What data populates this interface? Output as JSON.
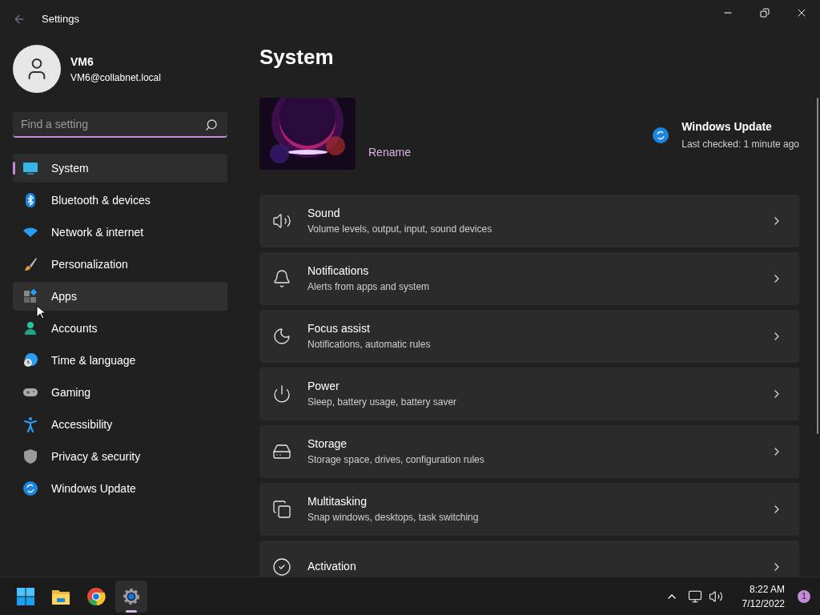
{
  "window": {
    "title": "Settings"
  },
  "user": {
    "name": "VM6",
    "email": "VM6@collabnet.local"
  },
  "search": {
    "placeholder": "Find a setting"
  },
  "sidebar": {
    "items": [
      {
        "label": "System",
        "selected": true,
        "hovered": false
      },
      {
        "label": "Bluetooth & devices",
        "selected": false,
        "hovered": false
      },
      {
        "label": "Network & internet",
        "selected": false,
        "hovered": false
      },
      {
        "label": "Personalization",
        "selected": false,
        "hovered": false
      },
      {
        "label": "Apps",
        "selected": false,
        "hovered": true
      },
      {
        "label": "Accounts",
        "selected": false,
        "hovered": false
      },
      {
        "label": "Time & language",
        "selected": false,
        "hovered": false
      },
      {
        "label": "Gaming",
        "selected": false,
        "hovered": false
      },
      {
        "label": "Accessibility",
        "selected": false,
        "hovered": false
      },
      {
        "label": "Privacy & security",
        "selected": false,
        "hovered": false
      },
      {
        "label": "Windows Update",
        "selected": false,
        "hovered": false
      }
    ]
  },
  "page": {
    "title": "System",
    "rename": "Rename",
    "update": {
      "title": "Windows Update",
      "status": "Last checked: 1 minute ago"
    },
    "cards": [
      {
        "title": "Sound",
        "description": "Volume levels, output, input, sound devices"
      },
      {
        "title": "Notifications",
        "description": "Alerts from apps and system"
      },
      {
        "title": "Focus assist",
        "description": "Notifications, automatic rules"
      },
      {
        "title": "Power",
        "description": "Sleep, battery usage, battery saver"
      },
      {
        "title": "Storage",
        "description": "Storage space, drives, configuration rules"
      },
      {
        "title": "Multitasking",
        "description": "Snap windows, desktops, task switching"
      },
      {
        "title": "Activation"
      }
    ]
  },
  "taskbar": {
    "apps": [
      {
        "selected": false
      },
      {
        "selected": false
      },
      {
        "selected": false
      },
      {
        "selected": true
      }
    ],
    "time": "8:22 AM",
    "date": "7/12/2022",
    "notifications": "1"
  }
}
